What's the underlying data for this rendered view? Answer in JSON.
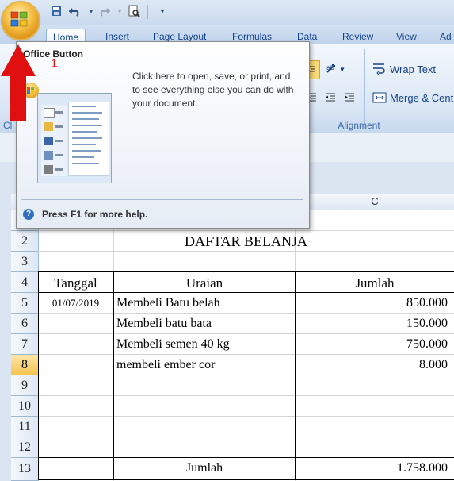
{
  "ribbon": {
    "tabs": [
      {
        "label": "Home"
      },
      {
        "label": "Insert"
      },
      {
        "label": "Page Layout"
      },
      {
        "label": "Formulas"
      },
      {
        "label": "Data"
      },
      {
        "label": "Review"
      },
      {
        "label": "View"
      },
      {
        "label": "Ad"
      }
    ],
    "wrap_text": "Wrap Text",
    "merge_center": "Merge & Cent",
    "alignment_group": "Alignment",
    "clipboard_group_partial": "Cl"
  },
  "tooltip": {
    "title": "Office Button",
    "body": "Click here to open, save, or print, and to see everything else you can do with your document.",
    "help": "Press F1 for more help."
  },
  "annotation": {
    "step_number": "1",
    "arrow_color": "#e01010"
  },
  "sheet": {
    "column_c": "C",
    "rows": [
      "2",
      "3",
      "4",
      "5",
      "6",
      "7",
      "8",
      "9",
      "10",
      "11",
      "12",
      "13"
    ],
    "selected_row": "8",
    "title": "DAFTAR BELANJA",
    "headers": {
      "tanggal": "Tanggal",
      "uraian": "Uraian",
      "jumlah": "Jumlah"
    },
    "items": [
      {
        "date": "01/07/2019",
        "desc": "Membeli Batu belah",
        "amount": "850.000"
      },
      {
        "date": "",
        "desc": "Membeli batu bata",
        "amount": "150.000"
      },
      {
        "date": "",
        "desc": "Membeli semen 40 kg",
        "amount": "750.000"
      },
      {
        "date": "",
        "desc": "membeli ember cor",
        "amount": "8.000"
      }
    ],
    "total_label": "Jumlah",
    "total_amount": "1.758.000"
  },
  "colors": {
    "ribbon_text": "#15428b",
    "selected_row": "#f6c350"
  }
}
